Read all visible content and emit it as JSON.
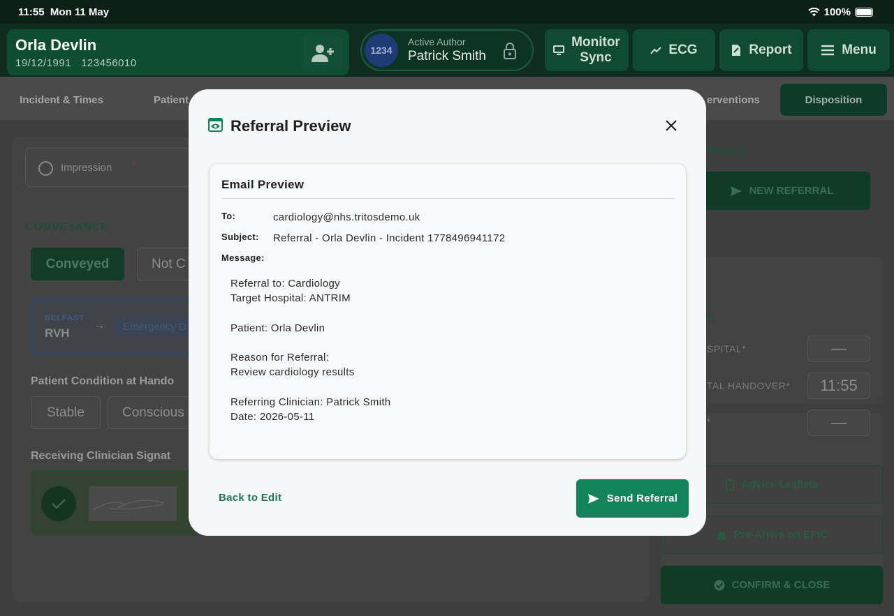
{
  "status_bar": {
    "time": "11:55",
    "date": "Mon 11 May",
    "battery": "100%"
  },
  "patient": {
    "name": "Orla Devlin",
    "dob": "19/12/1991",
    "id": "123456010"
  },
  "author": {
    "badge": "1234",
    "label": "Active Author",
    "name": "Patrick Smith"
  },
  "header_buttons": {
    "monitor_sync": "Monitor Sync",
    "monitor_line1": "Monitor",
    "monitor_line2": "Sync",
    "ecg": "ECG",
    "report": "Report",
    "menu": "Menu"
  },
  "tabs": {
    "incident": "Incident & Times",
    "patient": "Patient",
    "interventions": "erventions",
    "disposition": "Disposition"
  },
  "background": {
    "impression": "Impression",
    "impression_required": "*",
    "conveyance_title": "CONVEYANCE",
    "conveyed": "Conveyed",
    "not_conveyed": "Not C",
    "dest_city": "BELFAST",
    "dest_code": "RVH",
    "dest_arrow": "→",
    "dest_department": "Emergency D",
    "condition_title": "Patient Condition at Hando",
    "stable": "Stable",
    "conscious": "Conscious",
    "signature_title": "Receiving Clinician Signat",
    "referrals_title": "RRALS",
    "new_referral": "NEW REFERRAL",
    "times_title": "S",
    "label_hospital": "SPITAL*",
    "label_handover": "TAL HANDOVER*",
    "label_third": "*",
    "val_hospital": "—",
    "val_handover": "11:55",
    "val_third": "—",
    "advice_leaflets": "Advice Leaflets",
    "pre_arrive": "Pre-Arrive on EPIC",
    "confirm_close": "CONFIRM & CLOSE"
  },
  "modal": {
    "title": "Referral Preview",
    "email_heading": "Email Preview",
    "to_label": "To:",
    "to_value": "cardiology@nhs.tritosdemo.uk",
    "subject_label": "Subject:",
    "subject_value": "Referral - Orla Devlin - Incident 1778496941172",
    "message_label": "Message:",
    "message_lines": [
      "Referral to: Cardiology",
      "Target Hospital: ANTRIM",
      "",
      "Patient: Orla Devlin",
      "",
      "Reason for Referral:",
      "Review cardiology results",
      "",
      "Referring Clinician: Patrick Smith",
      "Date: 2026-05-11"
    ],
    "back_label": "Back to Edit",
    "send_label": "Send Referral"
  },
  "colors": {
    "accent": "#12835a",
    "link": "#1b7a52",
    "header_bg": "#0e2c20"
  }
}
